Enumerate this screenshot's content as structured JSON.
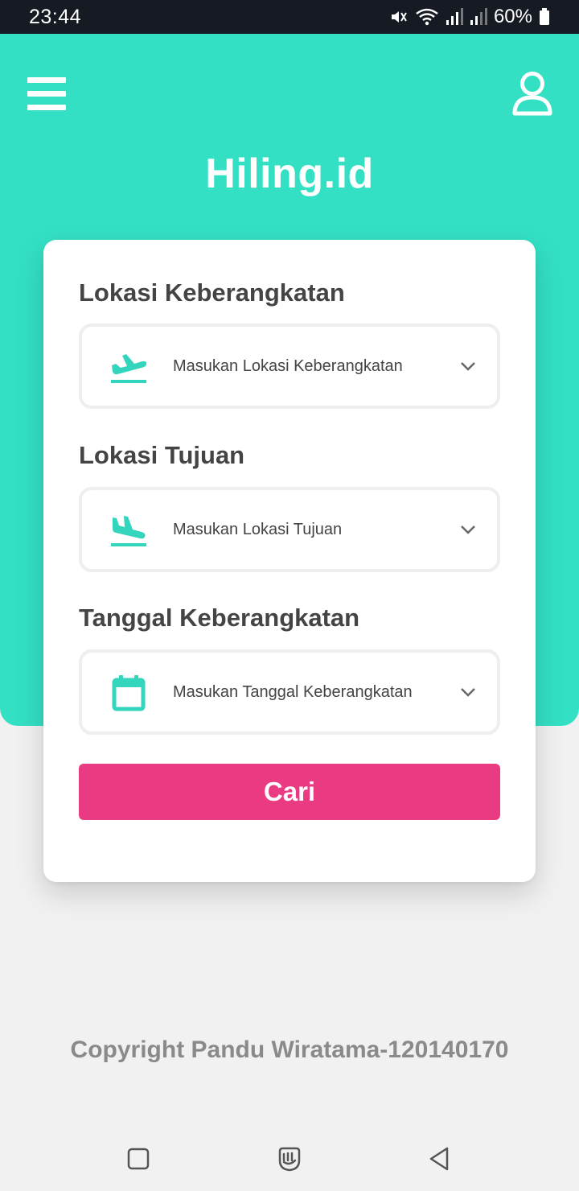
{
  "status_bar": {
    "time": "23:44",
    "battery": "60%",
    "icons": [
      "mute-icon",
      "wifi-icon",
      "signal-icon",
      "signal-icon",
      "battery-icon"
    ]
  },
  "header": {
    "title": "Hiling.id",
    "menu_icon": "hamburger-menu-icon",
    "profile_icon": "user-profile-icon",
    "background_color": "#33e0c4"
  },
  "form": {
    "departure": {
      "label": "Lokasi Keberangkatan",
      "placeholder": "Masukan Lokasi Keberangkatan",
      "icon": "plane-takeoff-icon"
    },
    "destination": {
      "label": "Lokasi Tujuan",
      "placeholder": "Masukan Lokasi Tujuan",
      "icon": "plane-landing-icon"
    },
    "date": {
      "label": "Tanggal Keberangkatan",
      "placeholder": "Masukan Tanggal Keberangkatan",
      "icon": "calendar-icon"
    },
    "search_label": "Cari",
    "search_color": "#e93a82"
  },
  "footer": {
    "copyright": "Copyright Pandu Wiratama-120140170"
  },
  "nav_bar": {
    "icons": [
      "recent-apps-icon",
      "home-icon",
      "back-icon"
    ]
  }
}
